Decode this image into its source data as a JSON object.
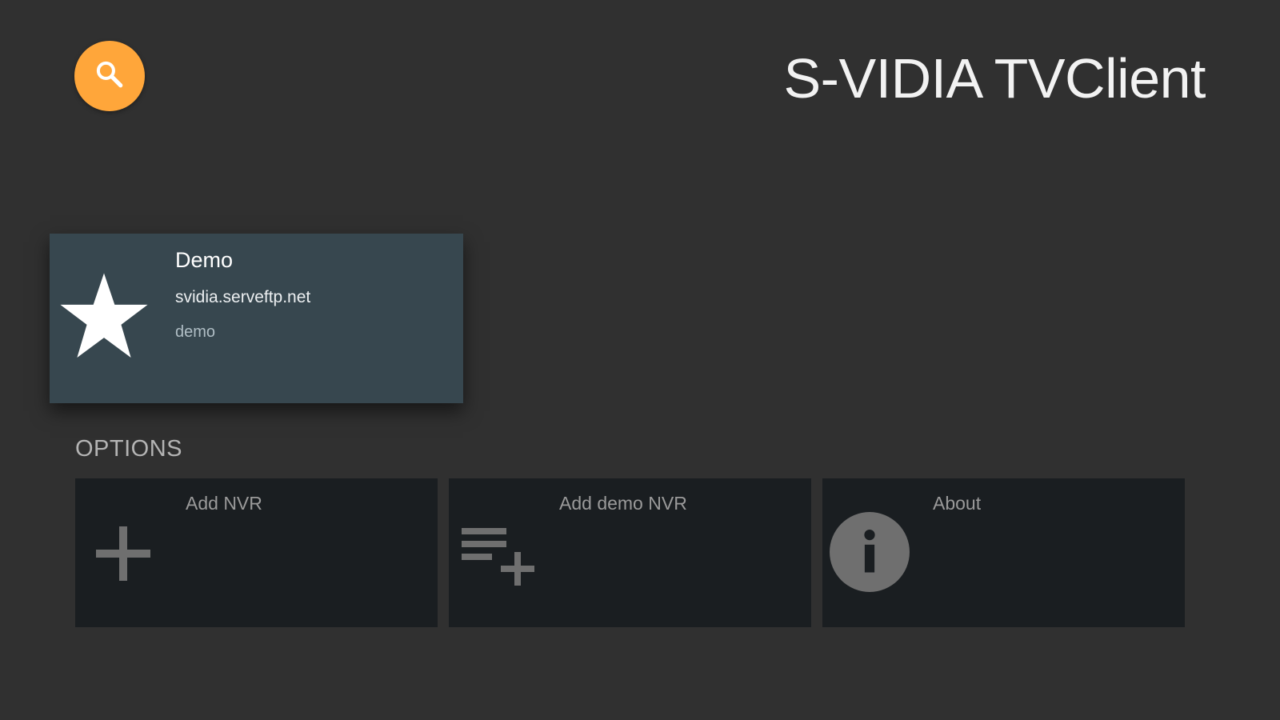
{
  "header": {
    "title": "S-VIDIA TVClient",
    "search_icon": "search-icon",
    "accent_color": "#ffa63a"
  },
  "nvr_list": [
    {
      "name": "Demo",
      "host": "svidia.serveftp.net",
      "user": "demo",
      "icon": "star-icon",
      "card_color": "#37474f"
    }
  ],
  "options": {
    "header": "OPTIONS",
    "items": [
      {
        "label": "Add NVR",
        "icon": "plus-icon"
      },
      {
        "label": "Add demo NVR",
        "icon": "playlist-add-icon"
      },
      {
        "label": "About",
        "icon": "info-icon"
      }
    ]
  }
}
